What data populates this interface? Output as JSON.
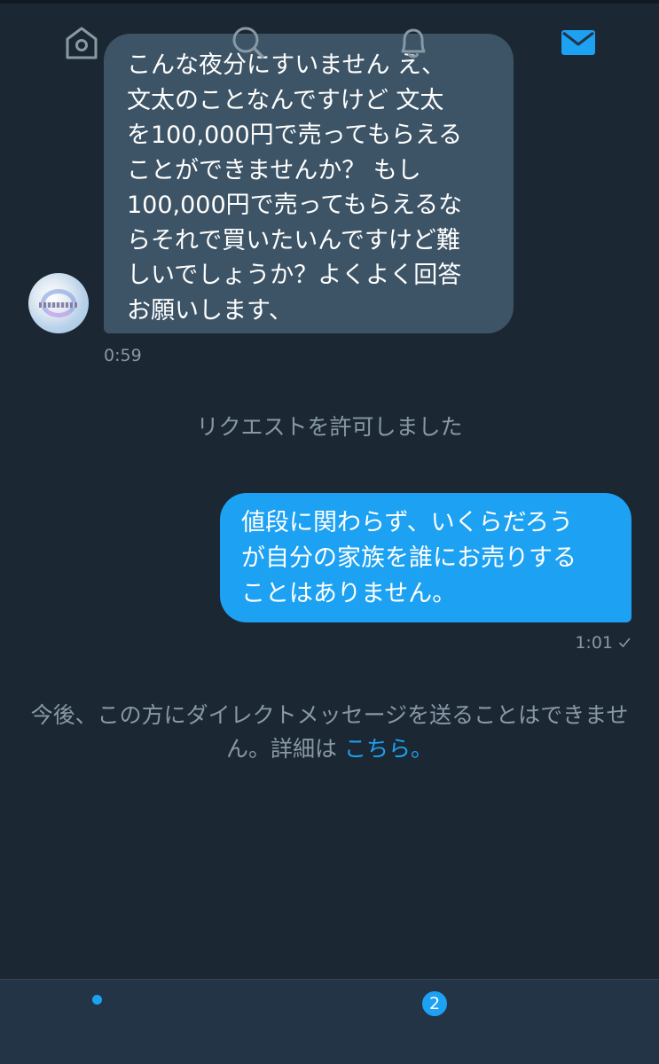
{
  "conversation": {
    "incoming": {
      "text": "こんな夜分にすいません え、\n文太のことなんですけど  文太\nを100,000円で売ってもらえる\nことができませんか？ もし\n100,000円で売ってもらえるな\nらそれで買いたいんですけど難\nしいでしょうか？よくよく回答\nお願いします、",
      "time": "0:59"
    },
    "system_request": "リクエストを許可しました",
    "outgoing": {
      "text": "値段に関わらず、いくらだろう\nが自分の家族を誰にお売りする\nことはありません。",
      "time": "1:01"
    },
    "system_blocked": {
      "text": "今後、この方にダイレクトメッセージを送ることはできません。詳細は ",
      "link": "こちら。"
    }
  },
  "tabbar": {
    "items": [
      {
        "name": "home",
        "icon": "home-icon",
        "has_dot": true
      },
      {
        "name": "search",
        "icon": "search-icon"
      },
      {
        "name": "notifications",
        "icon": "bell-icon",
        "badge": "2"
      },
      {
        "name": "messages",
        "icon": "mail-icon",
        "active": true
      }
    ]
  },
  "colors": {
    "background": "#1b2733",
    "incoming_bubble": "#3d5466",
    "outgoing_bubble": "#1da1f2",
    "muted_text": "#8899a6",
    "accent": "#1da1f2",
    "tabbar": "#243447"
  }
}
